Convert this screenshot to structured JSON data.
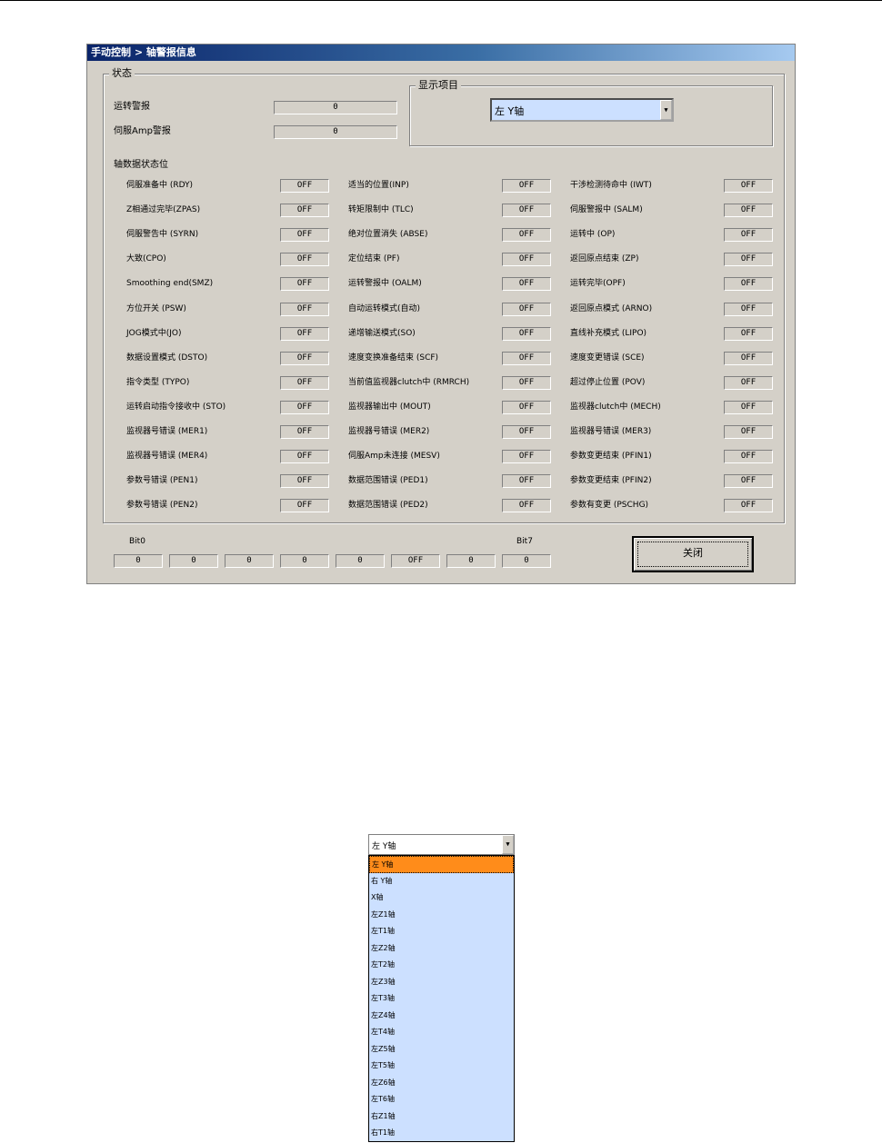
{
  "window": {
    "title": "手动控制 > 轴警报信息"
  },
  "status_group": {
    "label": "状态"
  },
  "operation_alarm": {
    "label": "运转警报",
    "value": "0"
  },
  "servo_amp_alarm": {
    "label": "伺服Amp警报",
    "value": "0"
  },
  "display_group": {
    "label": "显示项目",
    "selected": "左 Y轴"
  },
  "axis_status_heading": "轴数据状态位",
  "status_columns": [
    [
      {
        "label": "伺服准备中 (RDY)",
        "value": "OFF"
      },
      {
        "label": "Z相通过完毕(ZPAS)",
        "value": "OFF"
      },
      {
        "label": "伺服警告中 (SYRN)",
        "value": "OFF"
      },
      {
        "label": "大致(CPO)",
        "value": "OFF"
      },
      {
        "label": "Smoothing end(SMZ)",
        "value": "OFF"
      },
      {
        "label": "方位开关 (PSW)",
        "value": "OFF"
      },
      {
        "label": "JOG模式中(JO)",
        "value": "OFF"
      },
      {
        "label": "数据设置模式 (DSTO)",
        "value": "OFF"
      },
      {
        "label": "指令类型 (TYPO)",
        "value": "OFF"
      },
      {
        "label": "运转启动指令接收中 (STO)",
        "value": "OFF"
      },
      {
        "label": "监视器号错误 (MER1)",
        "value": "OFF"
      },
      {
        "label": "监视器号错误 (MER4)",
        "value": "OFF"
      },
      {
        "label": "参数号错误 (PEN1)",
        "value": "OFF"
      },
      {
        "label": "参数号错误 (PEN2)",
        "value": "OFF"
      }
    ],
    [
      {
        "label": "适当的位置(INP)",
        "value": "OFF"
      },
      {
        "label": "转矩限制中 (TLC)",
        "value": "OFF"
      },
      {
        "label": "绝对位置消失 (ABSE)",
        "value": "OFF"
      },
      {
        "label": "定位结束 (PF)",
        "value": "OFF"
      },
      {
        "label": "运转警报中 (OALM)",
        "value": "OFF"
      },
      {
        "label": "自动运转模式(自动)",
        "value": "OFF"
      },
      {
        "label": "递增输送模式(SO)",
        "value": "OFF"
      },
      {
        "label": "速度变换准备结束 (SCF)",
        "value": "OFF"
      },
      {
        "label": "当前值监视器clutch中 (RMRCH)",
        "value": "OFF"
      },
      {
        "label": "监视器输出中 (MOUT)",
        "value": "OFF"
      },
      {
        "label": "监视器号错误 (MER2)",
        "value": "OFF"
      },
      {
        "label": "伺服Amp未连接 (MESV)",
        "value": "OFF"
      },
      {
        "label": "数据范围错误 (PED1)",
        "value": "OFF"
      },
      {
        "label": "数据范围错误 (PED2)",
        "value": "OFF"
      }
    ],
    [
      {
        "label": "干涉检测待命中 (IWT)",
        "value": "OFF"
      },
      {
        "label": "伺服警报中 (SALM)",
        "value": "OFF"
      },
      {
        "label": "运转中 (OP)",
        "value": "OFF"
      },
      {
        "label": "返回原点结束 (ZP)",
        "value": "OFF"
      },
      {
        "label": "运转完毕(OPF)",
        "value": "OFF"
      },
      {
        "label": "返回原点模式 (ARNO)",
        "value": "OFF"
      },
      {
        "label": "直线补充模式 (LIPO)",
        "value": "OFF"
      },
      {
        "label": "速度变更错误 (SCE)",
        "value": "OFF"
      },
      {
        "label": "超过停止位置 (POV)",
        "value": "OFF"
      },
      {
        "label": "监视器clutch中 (MECH)",
        "value": "OFF"
      },
      {
        "label": "监视器号错误 (MER3)",
        "value": "OFF"
      },
      {
        "label": "参数变更结束 (PFIN1)",
        "value": "OFF"
      },
      {
        "label": "参数变更结束 (PFIN2)",
        "value": "OFF"
      },
      {
        "label": "参数有变更 (PSCHG)",
        "value": "OFF"
      }
    ]
  ],
  "bits": {
    "bit0_label": "Bit0",
    "bit7_label": "Bit7",
    "values": [
      "0",
      "0",
      "0",
      "0",
      "0",
      "OFF",
      "0",
      "0"
    ]
  },
  "close_button": "关闭",
  "dropdown_demo": {
    "selected": "左 Y轴",
    "options": [
      "左 Y轴",
      "右 Y轴",
      "X轴",
      "左Z1轴",
      "左T1轴",
      "左Z2轴",
      "左T2轴",
      "左Z3轴",
      "左T3轴",
      "左Z4轴",
      "左T4轴",
      "左Z5轴",
      "左T5轴",
      "左Z6轴",
      "左T6轴",
      "右Z1轴",
      "右T1轴"
    ],
    "highlighted_index": 0
  },
  "colors": {
    "window_bg": "#d4d0c8",
    "titlebar_start": "#0a246a",
    "combo_bg": "#cce0ff",
    "highlight": "#ff8c1a"
  }
}
